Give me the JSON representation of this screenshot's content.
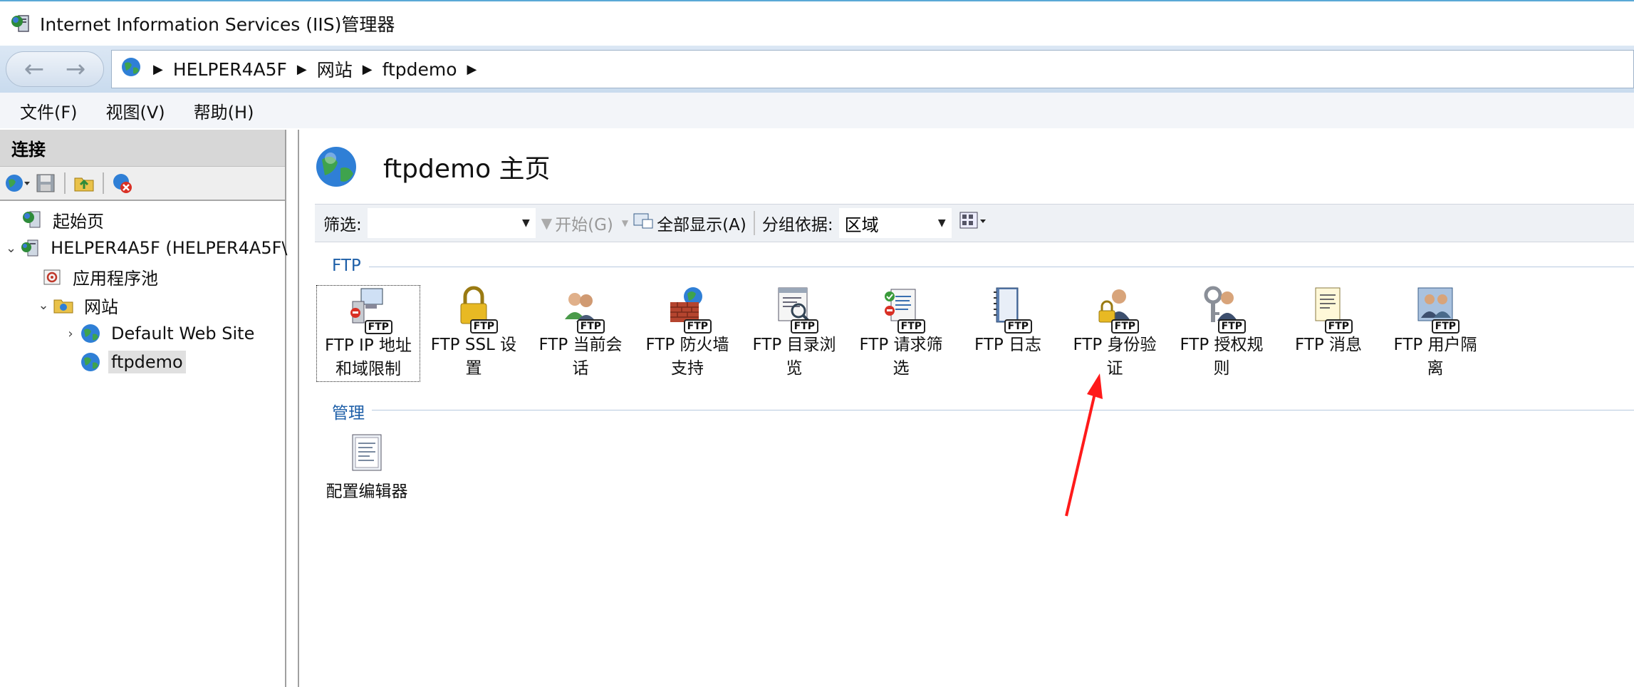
{
  "window": {
    "title": "Internet Information Services (IIS)管理器"
  },
  "address": {
    "crumbs": [
      "HELPER4A5F",
      "网站",
      "ftpdemo"
    ]
  },
  "menu": {
    "items": [
      "文件(F)",
      "视图(V)",
      "帮助(H)"
    ]
  },
  "connections": {
    "header": "连接",
    "tree": {
      "start_page": "起始页",
      "server": "HELPER4A5F (HELPER4A5F\\",
      "app_pools": "应用程序池",
      "sites": "网站",
      "default_site": "Default Web Site",
      "ftpdemo": "ftpdemo"
    }
  },
  "main": {
    "title": "ftpdemo 主页",
    "filter": {
      "label": "筛选:",
      "value": "",
      "start": "开始(G)",
      "show_all": "全部显示(A)",
      "group_by_label": "分组依据:",
      "group_by_value": "区域"
    },
    "groups": {
      "ftp": {
        "label": "FTP",
        "features": [
          {
            "line1": "FTP IP 地址",
            "line2": "和域限制",
            "icon": "ip-restriction-icon"
          },
          {
            "line1": "FTP SSL 设",
            "line2": "置",
            "icon": "ssl-lock-icon"
          },
          {
            "line1": "FTP 当前会",
            "line2": "话",
            "icon": "sessions-icon"
          },
          {
            "line1": "FTP 防火墙",
            "line2": "支持",
            "icon": "firewall-icon"
          },
          {
            "line1": "FTP 目录浏",
            "line2": "览",
            "icon": "directory-browsing-icon"
          },
          {
            "line1": "FTP 请求筛",
            "line2": "选",
            "icon": "request-filtering-icon"
          },
          {
            "line1": "FTP 日志",
            "line2": "",
            "icon": "logging-icon"
          },
          {
            "line1": "FTP 身份验",
            "line2": "证",
            "icon": "authentication-icon"
          },
          {
            "line1": "FTP 授权规",
            "line2": "则",
            "icon": "authorization-icon"
          },
          {
            "line1": "FTP 消息",
            "line2": "",
            "icon": "messages-icon"
          },
          {
            "line1": "FTP 用户隔",
            "line2": "离",
            "icon": "user-isolation-icon"
          }
        ]
      },
      "management": {
        "label": "管理",
        "features": [
          {
            "line1": "配置编辑器",
            "icon": "configuration-editor-icon"
          }
        ]
      }
    }
  },
  "badge_text": "FTP",
  "colors": {
    "accent": "#1e5fa8",
    "annotation_arrow": "#ff1a1a"
  }
}
